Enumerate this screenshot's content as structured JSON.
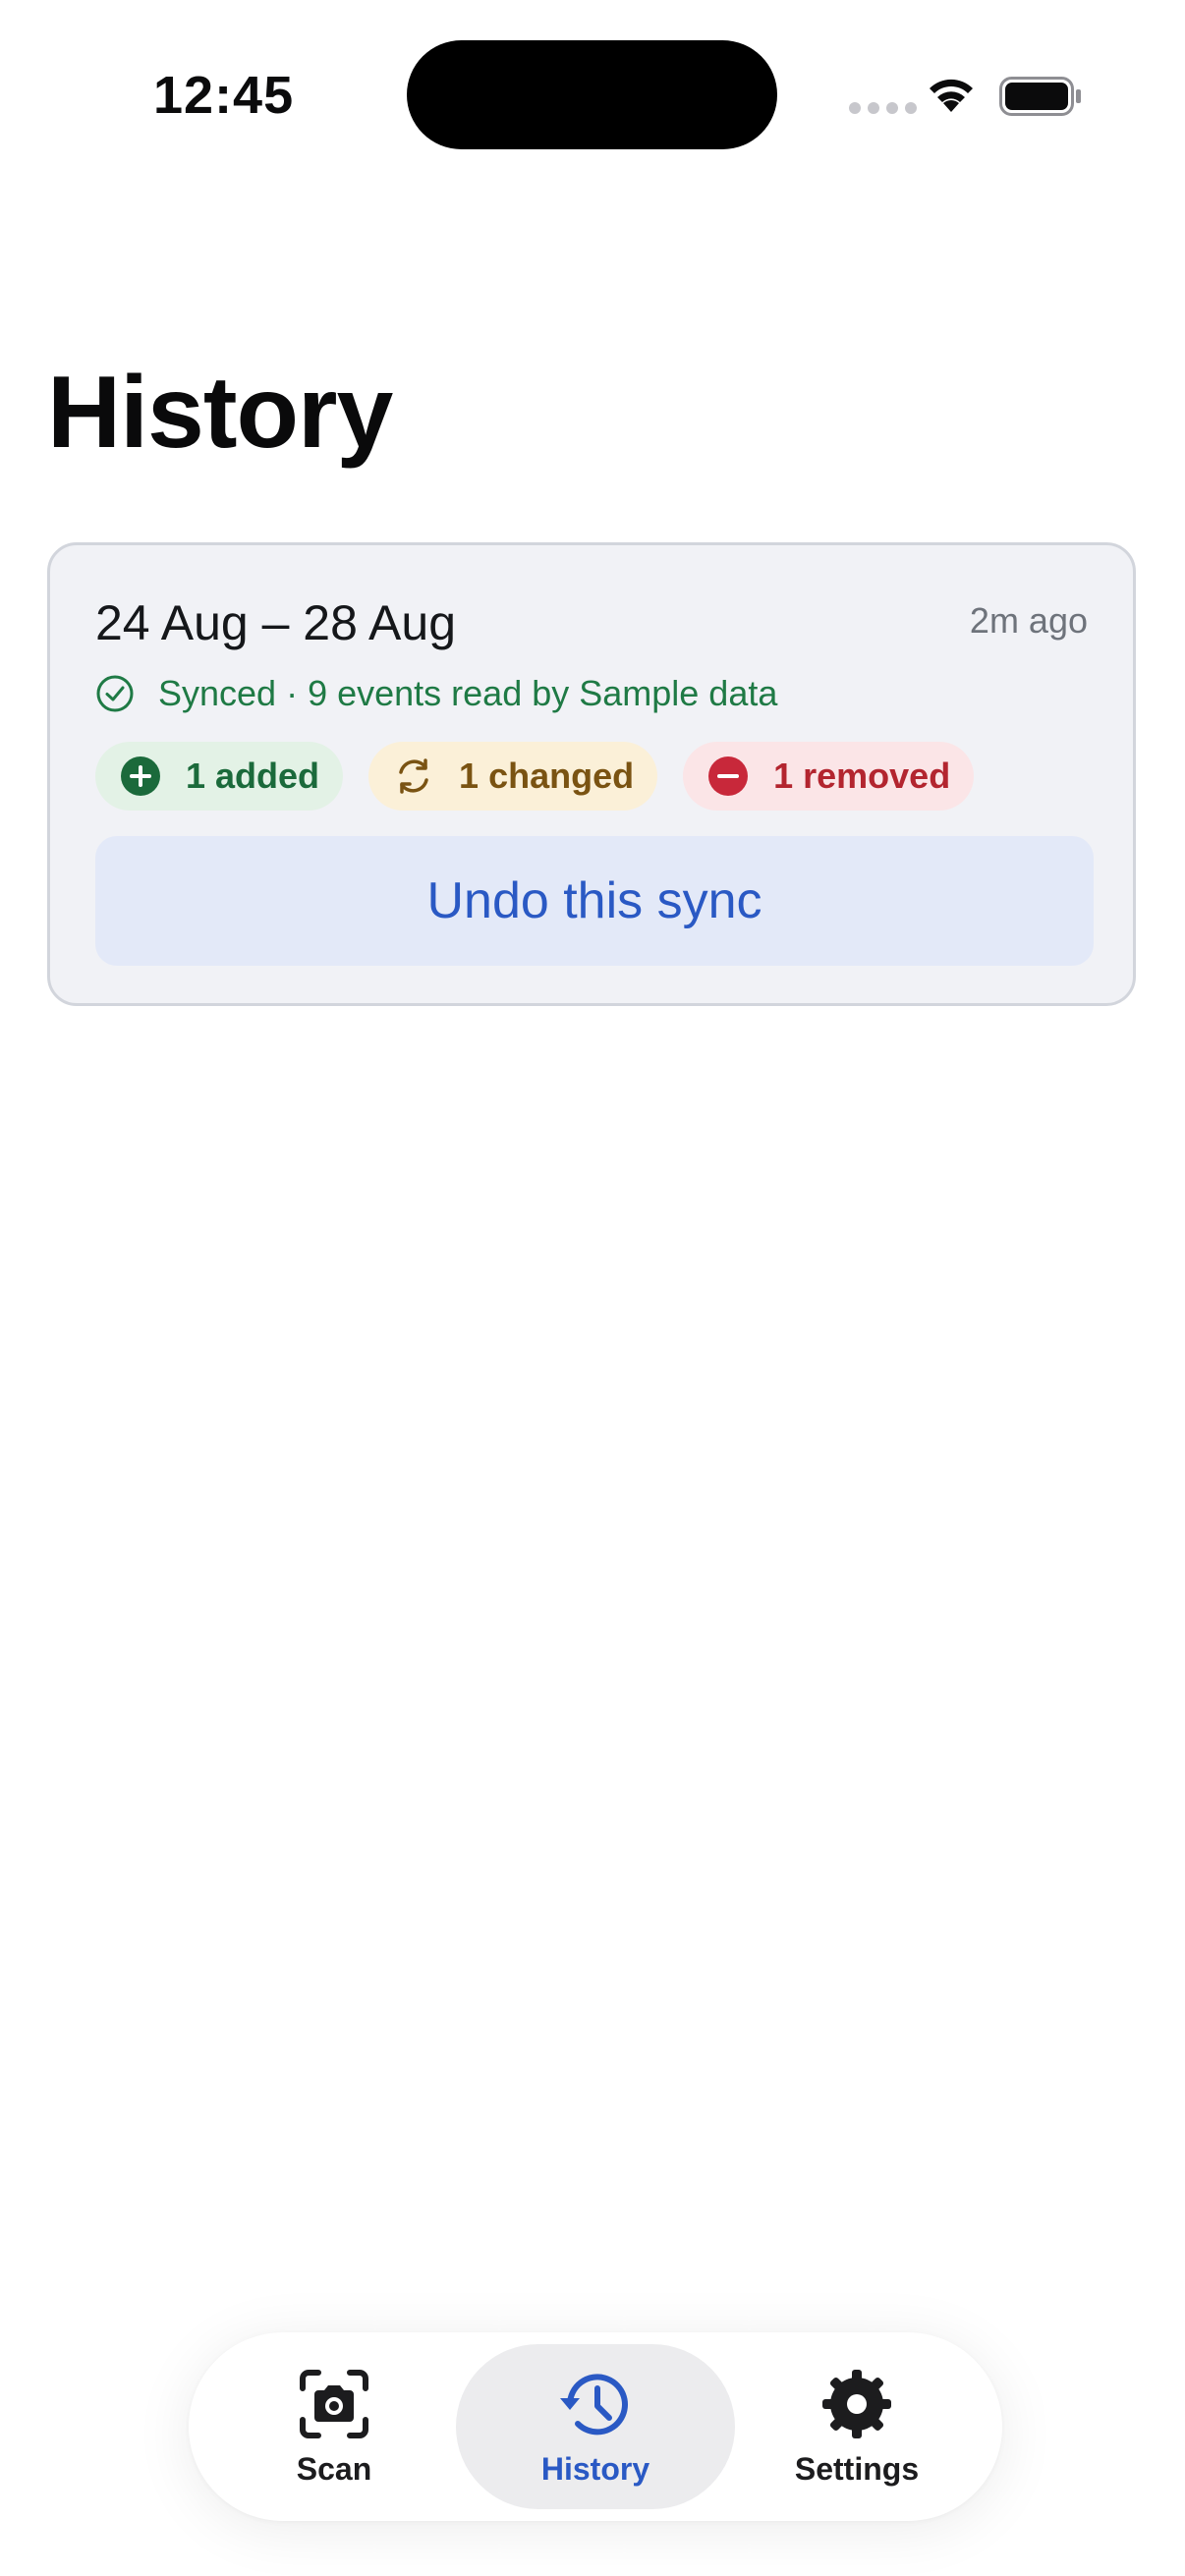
{
  "status_bar": {
    "time": "12:45"
  },
  "page": {
    "title": "History"
  },
  "sync_card": {
    "date_range": "24 Aug – 28 Aug",
    "time_ago": "2m ago",
    "status_text": "Synced · 9 events read by Sample data",
    "chips": {
      "added": "1 added",
      "changed": "1 changed",
      "removed": "1 removed"
    },
    "undo_label": "Undo this sync"
  },
  "tab_bar": {
    "tabs": [
      {
        "label": "Scan",
        "icon": "camera-scan-icon"
      },
      {
        "label": "History",
        "icon": "history-clock-icon",
        "active": true
      },
      {
        "label": "Settings",
        "icon": "gear-icon"
      }
    ]
  },
  "colors": {
    "accent": "#2a59c4",
    "added": "#1b6a3b",
    "changed": "#7a5312",
    "removed": "#b3252f",
    "synced": "#1f7a45"
  }
}
